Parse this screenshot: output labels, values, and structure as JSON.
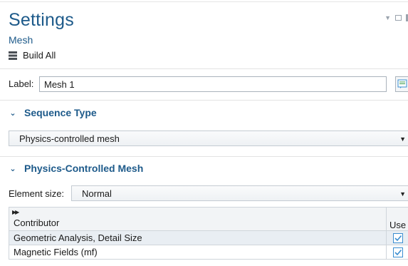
{
  "panel": {
    "title": "Settings",
    "subtitle": "Mesh"
  },
  "toolbar": {
    "build_all_label": "Build All",
    "build_all_icon": "build-all-icon"
  },
  "label_field": {
    "label": "Label:",
    "value": "Mesh 1"
  },
  "sequence_type": {
    "header": "Sequence Type",
    "selected": "Physics-controlled mesh"
  },
  "physics_controlled_mesh": {
    "header": "Physics-Controlled Mesh",
    "element_size_label": "Element size:",
    "element_size_selected": "Normal",
    "table": {
      "columns": [
        "Contributor",
        "Use"
      ],
      "rows": [
        {
          "contributor": "Geometric Analysis, Detail Size",
          "use": true
        },
        {
          "contributor": "Magnetic Fields (mf)",
          "use": true
        }
      ]
    }
  },
  "colors": {
    "accent": "#1d5a8a",
    "row_alt": "#e9eef3",
    "check": "#3a8dd0"
  }
}
